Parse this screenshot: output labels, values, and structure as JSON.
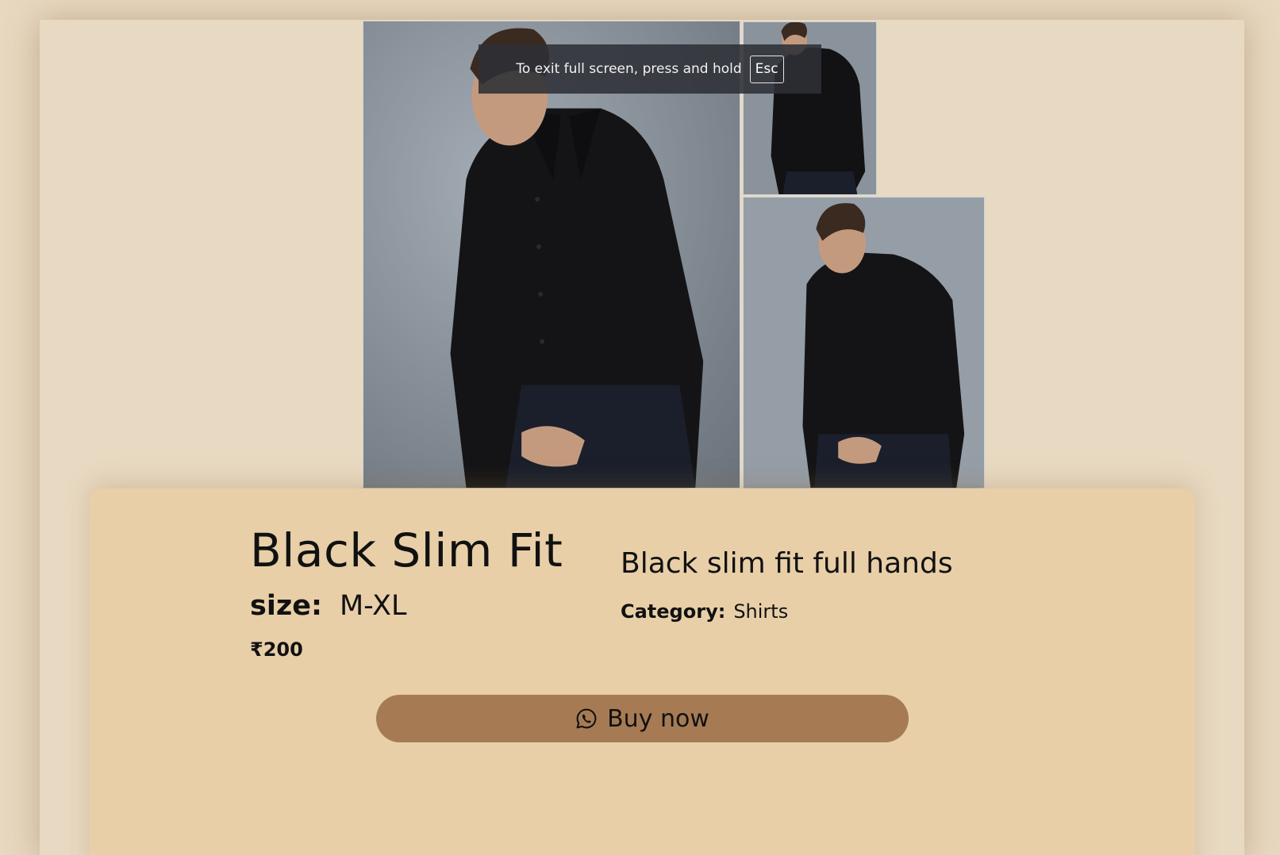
{
  "fullscreen_notice": {
    "message": "To exit full screen, press and hold",
    "key": "Esc"
  },
  "gallery": {
    "images": [
      {
        "alt": "man in black slim fit shirt"
      },
      {
        "alt": "man in black slim fit shirt"
      },
      {
        "alt": "man in black slim fit shirt"
      }
    ]
  },
  "product": {
    "title": "Black Slim Fit",
    "size_label": "size:",
    "size_value": "M-XL",
    "price": "₹200",
    "description": "Black slim fit full hands",
    "category_label": "Category:",
    "category_value": "Shirts"
  },
  "buy_button": {
    "label": "Buy now",
    "icon": "whatsapp-icon"
  },
  "colors": {
    "page_background": "#e8d8c0",
    "card_background": "#e8cfa8",
    "button_background": "#a67b54"
  }
}
